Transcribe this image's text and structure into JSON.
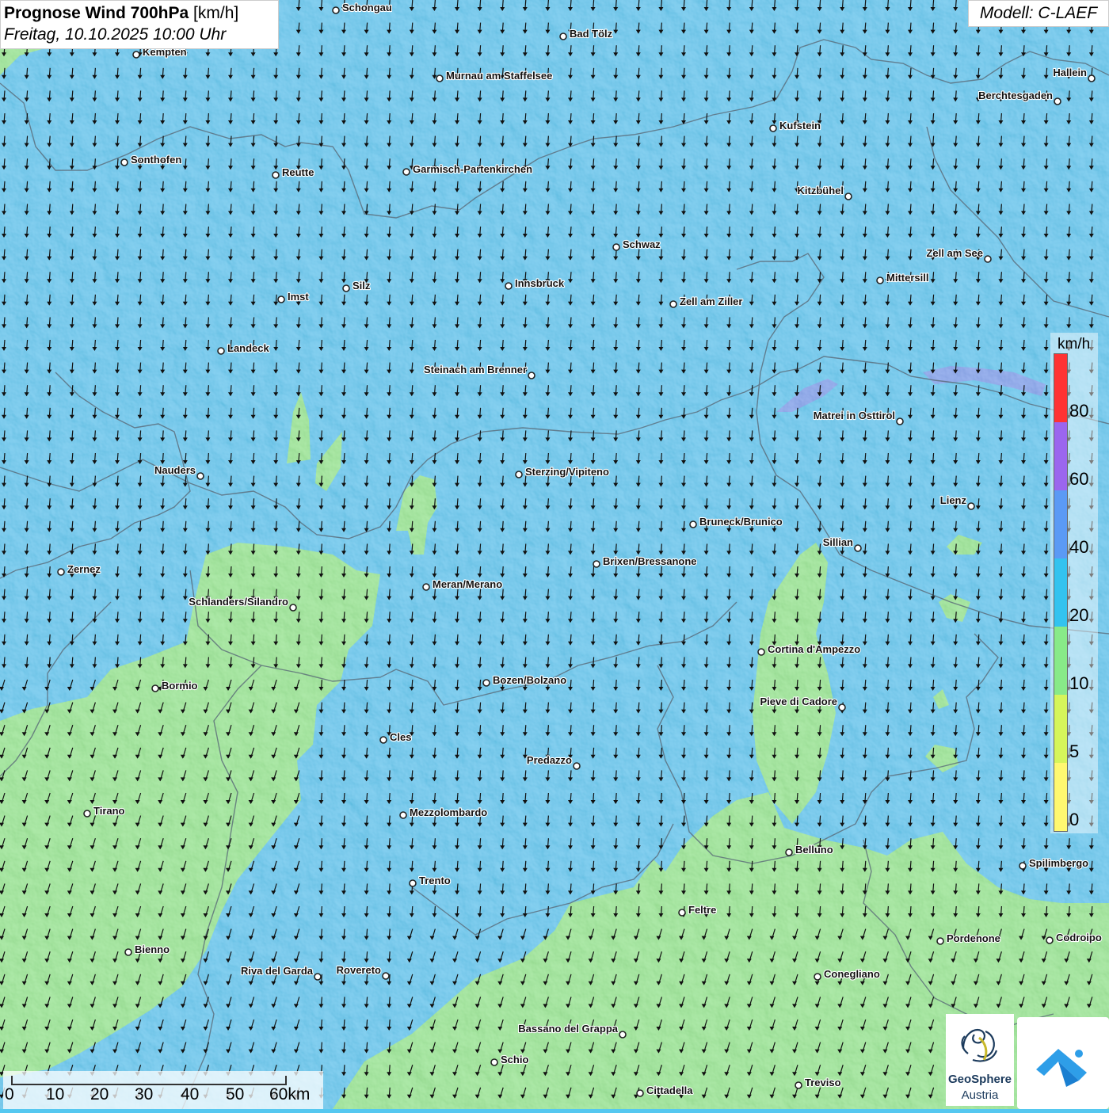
{
  "title": {
    "main": "Prognose Wind 700hPa",
    "unit": "[km/h]",
    "date": "Freitag, 10.10.2025 10:00 Uhr"
  },
  "model": "Modell: C-LAEF",
  "legend": {
    "unit": "km/h",
    "ticks": [
      "80",
      "60",
      "40",
      "20",
      "10",
      "5",
      "0"
    ],
    "colors": [
      "#ff3333",
      "#9b66ee",
      "#5b9af5",
      "#33c3ef",
      "#88ea88",
      "#d6f55a",
      "#fff870"
    ]
  },
  "scale": {
    "labels": [
      "0",
      "10",
      "20",
      "30",
      "40",
      "50",
      "60km"
    ]
  },
  "logo": {
    "name": "GeoSphere",
    "sub": "Austria"
  },
  "cities": [
    {
      "name": "Schongau",
      "label_side": "right"
    },
    {
      "name": "Bad Tölz",
      "label_side": "right"
    },
    {
      "name": "Kempten",
      "label_side": "right"
    },
    {
      "name": "Murnau am Staffelsee",
      "label_side": "right"
    },
    {
      "name": "Hallein",
      "label_side": "left"
    },
    {
      "name": "Berchtesgaden",
      "label_side": "left"
    },
    {
      "name": "Kufstein",
      "label_side": "right"
    },
    {
      "name": "Sonthofen",
      "label_side": "right"
    },
    {
      "name": "Reutte",
      "label_side": "right"
    },
    {
      "name": "Garmisch-Partenkirchen",
      "label_side": "right"
    },
    {
      "name": "Kitzbühel",
      "label_side": "left"
    },
    {
      "name": "Schwaz",
      "label_side": "right"
    },
    {
      "name": "Zell am See",
      "label_side": "left"
    },
    {
      "name": "Mittersill",
      "label_side": "right"
    },
    {
      "name": "Innsbruck",
      "label_side": "right"
    },
    {
      "name": "Silz",
      "label_side": "right"
    },
    {
      "name": "Imst",
      "label_side": "right"
    },
    {
      "name": "Zell am Ziller",
      "label_side": "right"
    },
    {
      "name": "Landeck",
      "label_side": "right"
    },
    {
      "name": "Steinach am Brenner",
      "label_side": "left"
    },
    {
      "name": "Matrei in Osttirol",
      "label_side": "left"
    },
    {
      "name": "Nauders",
      "label_side": "left"
    },
    {
      "name": "Sterzing/Vipiteno",
      "label_side": "right"
    },
    {
      "name": "Lienz",
      "label_side": "left"
    },
    {
      "name": "Bruneck/Brunico",
      "label_side": "right"
    },
    {
      "name": "Sillian",
      "label_side": "left"
    },
    {
      "name": "Zernez",
      "label_side": "right"
    },
    {
      "name": "Brixen/Bressanone",
      "label_side": "right"
    },
    {
      "name": "Meran/Merano",
      "label_side": "right"
    },
    {
      "name": "Schlanders/Silandro",
      "label_side": "left"
    },
    {
      "name": "Cortina d'Ampezzo",
      "label_side": "right"
    },
    {
      "name": "Bozen/Bolzano",
      "label_side": "right"
    },
    {
      "name": "Bormio",
      "label_side": "right"
    },
    {
      "name": "Pieve di Cadore",
      "label_side": "left"
    },
    {
      "name": "Cles",
      "label_side": "right"
    },
    {
      "name": "Predazzo",
      "label_side": "left"
    },
    {
      "name": "Tirano",
      "label_side": "right"
    },
    {
      "name": "Mezzolombardo",
      "label_side": "right"
    },
    {
      "name": "Belluno",
      "label_side": "right"
    },
    {
      "name": "Spilimbergo",
      "label_side": "right"
    },
    {
      "name": "Trento",
      "label_side": "right"
    },
    {
      "name": "Feltre",
      "label_side": "right"
    },
    {
      "name": "Pordenone",
      "label_side": "right"
    },
    {
      "name": "Codroipo",
      "label_side": "right"
    },
    {
      "name": "Bienno",
      "label_side": "right"
    },
    {
      "name": "Riva del Garda",
      "label_side": "left"
    },
    {
      "name": "Rovereto",
      "label_side": "left"
    },
    {
      "name": "Conegliano",
      "label_side": "right"
    },
    {
      "name": "Bassano del Grappa",
      "label_side": "left"
    },
    {
      "name": "Schio",
      "label_side": "right"
    },
    {
      "name": "Treviso",
      "label_side": "right"
    },
    {
      "name": "Cittadella",
      "label_side": "right"
    }
  ]
}
